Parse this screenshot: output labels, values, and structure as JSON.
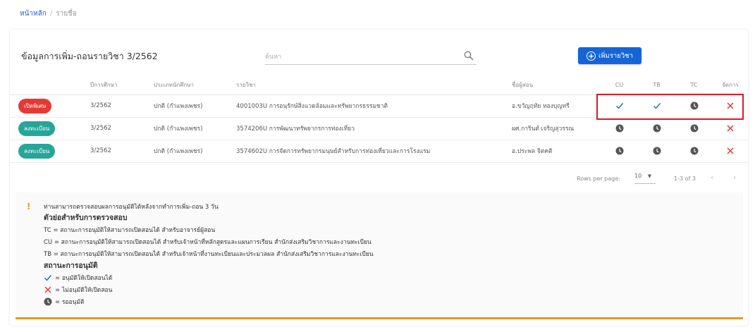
{
  "breadcrumb": {
    "home": "หน้าหลัก",
    "sep": "/",
    "current": "รายชื่อ"
  },
  "header": {
    "title": "ข้อมูลการเพิ่ม-ถอนรายวิชา 3/2562",
    "search_placeholder": "ค้นหา",
    "add_button": "เพิ่มรายวิชา"
  },
  "table": {
    "columns": {
      "year": "ปีการศึกษา",
      "type": "ประเภทนักศึกษา",
      "course": "รายวิชา",
      "teacher": "ชื่อผู้สอน",
      "cu": "CU",
      "tb": "TB",
      "tc": "TC",
      "manage": "จัดการ"
    },
    "rows": [
      {
        "status": "เปิดพิเศษ",
        "status_color": "#e53935",
        "year": "3/2562",
        "type": "ปกติ (กำแพงเพชร)",
        "course": "4001003U การอนุรักษ์สิ่งแวดล้อมและทรัพยากรธรรมชาติ",
        "teacher": "อ.ขวัญฤทัย ทองบุญทรี",
        "cu": "check",
        "tb": "check",
        "tc": "clock",
        "manage": "delete"
      },
      {
        "status": "ลงทะเบียน",
        "status_color": "#26a69a",
        "year": "3/2562",
        "type": "ปกติ (กำแพงเพชร)",
        "course": "3574206U การพัฒนาทรัพยากรการท่องเที่ยว",
        "teacher": "ผศ.การินต์ เจริญสุวรรณ",
        "cu": "clock",
        "tb": "clock",
        "tc": "clock",
        "manage": "delete"
      },
      {
        "status": "ลงทะเบียน",
        "status_color": "#26a69a",
        "year": "3/2562",
        "type": "ปกติ (กำแพงเพชร)",
        "course": "3574602U การจัดการทรัพยากรมนุษย์สำหรับการท่องเที่ยวและการโรงแรม",
        "teacher": "อ.ประพล จิตคติ",
        "cu": "clock",
        "tb": "clock",
        "tc": "clock",
        "manage": "delete"
      }
    ]
  },
  "pagination": {
    "rows_per_page_label": "Rows per page:",
    "rows_per_page": "10",
    "range": "1-3 of 3"
  },
  "note": {
    "warning": "ท่านสามารถตรวจสอบผลการอนุมัติได้หลังจากทำการเพิ่ม-ถอน 3 วัน",
    "abbr_heading": "ตัวย่อสำหรับการตรวจสอบ",
    "tc": "TC = สถานะการอนุมัติให้สามารถเปิดสอนได้ สำหรับอาจารย์ผู้สอน",
    "cu": "CU = สถานะการอนุมัติให้สามารถเปิดสอนได้ สำหรับเจ้าหน้าที่หลักสูตรและแผนการเรียน สำนักส่งเสริมวิชาการและงานทะเบียน",
    "tb": "TB = สถานะการอนุมัติให้สามารถเปิดสอนได้ สำหรับเจ้าหน้าที่งานทะเบียนและประมวลผล สำนักส่งเสริมวิชาการและงานทะเบียน",
    "status_heading": "สถานะการอนุมัติ",
    "legend_approved": "= อนุมัติให้เปิดสอนได้",
    "legend_rejected": "= ไม่อนุมัติให้เปิดสอน",
    "legend_pending": "= รออนุมัติ"
  },
  "colors": {
    "primary": "#1565d8",
    "check": "#1e63c9",
    "delete": "#e53935",
    "clock": "#555555",
    "accent": "#e89a1a"
  }
}
